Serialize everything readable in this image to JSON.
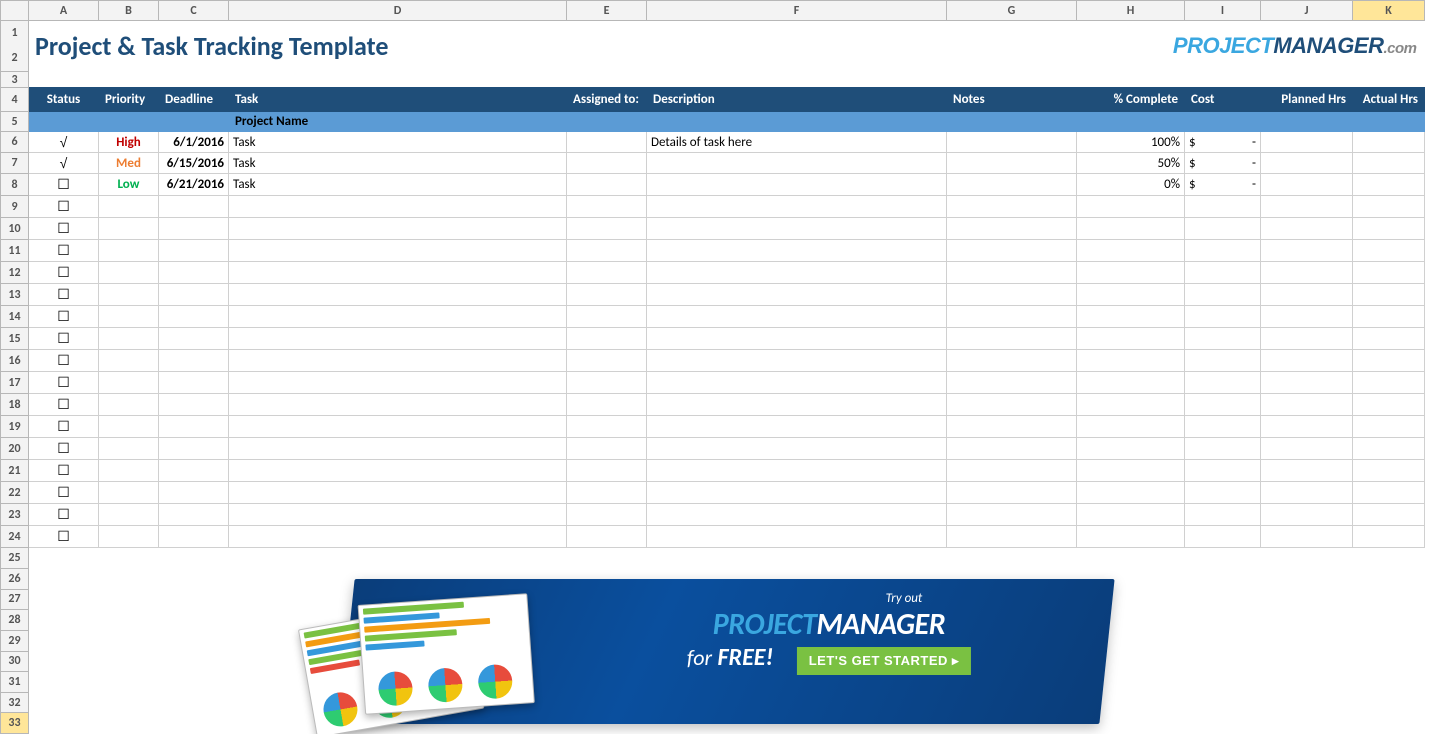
{
  "columns": [
    "A",
    "B",
    "C",
    "D",
    "E",
    "F",
    "G",
    "H",
    "I",
    "J",
    "K"
  ],
  "selected_column": "K",
  "row_numbers": [
    1,
    2,
    3,
    4,
    5,
    6,
    7,
    8,
    9,
    10,
    11,
    12,
    13,
    14,
    15,
    16,
    17,
    18,
    19,
    20,
    21,
    22,
    23,
    24,
    25,
    26,
    27,
    28,
    29,
    30,
    31,
    32,
    33
  ],
  "selected_row": 33,
  "title": "Project & Task Tracking Template",
  "logo": {
    "part1": "PROJECT",
    "part2": "MANAGER",
    "part3": ".com"
  },
  "headers": {
    "status": "Status",
    "priority": "Priority",
    "deadline": "Deadline",
    "task": "Task",
    "assigned": "Assigned to:",
    "description": "Description",
    "notes": "Notes",
    "pct_complete": "% Complete",
    "cost": "Cost",
    "planned_hrs": "Planned Hrs",
    "actual_hrs": "Actual Hrs"
  },
  "subheader": {
    "task": "Project Name"
  },
  "check_mark": "√",
  "check_box": "☐",
  "rows": [
    {
      "idx": 6,
      "status": "√",
      "priority": "High",
      "prio_class": "prio-high",
      "deadline": "6/1/2016",
      "task": "Task",
      "assigned": "",
      "description": "Details of task here",
      "notes": "",
      "pct": "100%",
      "cost_sym": "$",
      "cost_val": "-",
      "planned": "",
      "actual": ""
    },
    {
      "idx": 7,
      "status": "√",
      "priority": "Med",
      "prio_class": "prio-med",
      "deadline": "6/15/2016",
      "task": "Task",
      "assigned": "",
      "description": "",
      "notes": "",
      "pct": "50%",
      "cost_sym": "$",
      "cost_val": "-",
      "planned": "",
      "actual": ""
    },
    {
      "idx": 8,
      "status": "☐",
      "priority": "Low",
      "prio_class": "prio-low",
      "deadline": "6/21/2016",
      "task": "Task",
      "assigned": "",
      "description": "",
      "notes": "",
      "pct": "0%",
      "cost_sym": "$",
      "cost_val": "-",
      "planned": "",
      "actual": ""
    },
    {
      "idx": 9,
      "status": "☐"
    },
    {
      "idx": 10,
      "status": "☐"
    },
    {
      "idx": 11,
      "status": "☐"
    },
    {
      "idx": 12,
      "status": "☐"
    },
    {
      "idx": 13,
      "status": "☐"
    },
    {
      "idx": 14,
      "status": "☐"
    },
    {
      "idx": 15,
      "status": "☐"
    },
    {
      "idx": 16,
      "status": "☐"
    },
    {
      "idx": 17,
      "status": "☐"
    },
    {
      "idx": 18,
      "status": "☐"
    },
    {
      "idx": 19,
      "status": "☐"
    },
    {
      "idx": 20,
      "status": "☐"
    },
    {
      "idx": 21,
      "status": "☐"
    },
    {
      "idx": 22,
      "status": "☐"
    },
    {
      "idx": 23,
      "status": "☐"
    },
    {
      "idx": 24,
      "status": "☐"
    }
  ],
  "banner": {
    "try": "Try out",
    "pm1": "PROJECT",
    "pm2": "MANAGER",
    "for": "for",
    "free": "FREE!",
    "button": "LET'S GET STARTED"
  }
}
